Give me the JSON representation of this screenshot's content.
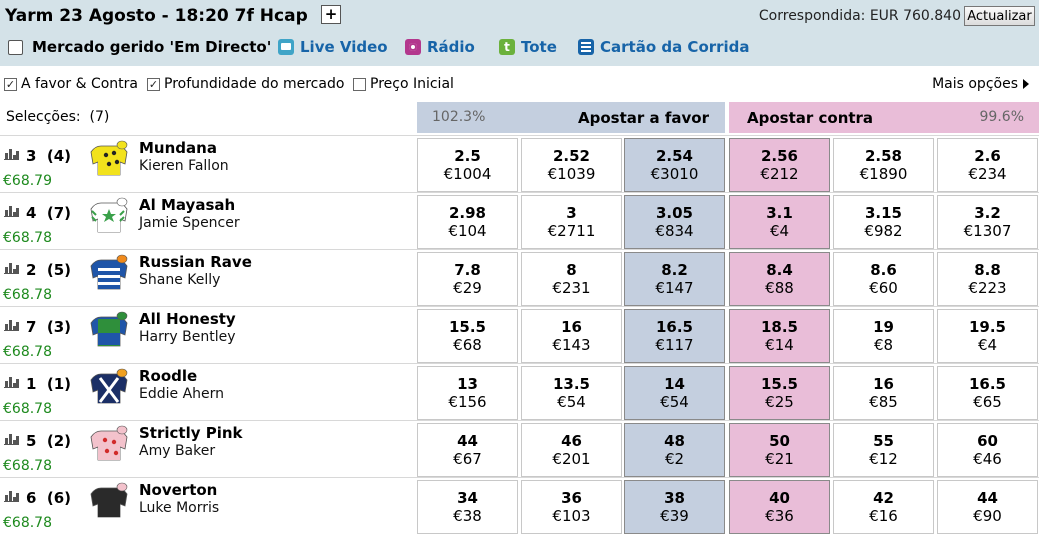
{
  "header": {
    "title": "Yarm 23 Agosto - 18:20 7f Hcap",
    "plus_label": "+",
    "matched": "Correspondida: EUR 760.840",
    "refresh_label": "Actualizar"
  },
  "links": {
    "inplay": "Mercado gerido 'Em Directo'",
    "live_video": "Live Video",
    "radio": "Rádio",
    "tote": "Tote",
    "tote_icon_letter": "t",
    "race_card": "Cartão da Corrida"
  },
  "options": {
    "back_lay": "A favor & Contra",
    "back_lay_checked": true,
    "depth": "Profundidade do mercado",
    "depth_checked": true,
    "sp": "Preço Inicial",
    "sp_checked": false,
    "more": "Mais opções"
  },
  "columns": {
    "selections": "Selecções:",
    "count": "(7)",
    "back_pct": "102.3%",
    "back_label": "Apostar a favor",
    "lay_label": "Apostar contra",
    "lay_pct": "99.6%"
  },
  "runners": [
    {
      "number": "3",
      "draw": "(4)",
      "name": "Mundana",
      "jockey": "Kieren Fallon",
      "pl": "€68.79",
      "silk": "yellow-black-spots",
      "prices": [
        {
          "o": "2.5",
          "a": "€1004"
        },
        {
          "o": "2.52",
          "a": "€1039"
        },
        {
          "o": "2.54",
          "a": "€3010"
        },
        {
          "o": "2.56",
          "a": "€212"
        },
        {
          "o": "2.58",
          "a": "€1890"
        },
        {
          "o": "2.6",
          "a": "€234"
        }
      ]
    },
    {
      "number": "4",
      "draw": "(7)",
      "name": "Al Mayasah",
      "jockey": "Jamie Spencer",
      "pl": "€68.78",
      "silk": "white-green-star",
      "prices": [
        {
          "o": "2.98",
          "a": "€104"
        },
        {
          "o": "3",
          "a": "€2711"
        },
        {
          "o": "3.05",
          "a": "€834"
        },
        {
          "o": "3.1",
          "a": "€4"
        },
        {
          "o": "3.15",
          "a": "€982"
        },
        {
          "o": "3.2",
          "a": "€1307"
        }
      ]
    },
    {
      "number": "2",
      "draw": "(5)",
      "name": "Russian Rave",
      "jockey": "Shane Kelly",
      "pl": "€68.78",
      "silk": "blue-white-hoops",
      "prices": [
        {
          "o": "7.8",
          "a": "€29"
        },
        {
          "o": "8",
          "a": "€231"
        },
        {
          "o": "8.2",
          "a": "€147"
        },
        {
          "o": "8.4",
          "a": "€88"
        },
        {
          "o": "8.6",
          "a": "€60"
        },
        {
          "o": "8.8",
          "a": "€223"
        }
      ]
    },
    {
      "number": "7",
      "draw": "(3)",
      "name": "All Honesty",
      "jockey": "Harry Bentley",
      "pl": "€68.78",
      "silk": "green-blue",
      "prices": [
        {
          "o": "15.5",
          "a": "€68"
        },
        {
          "o": "16",
          "a": "€143"
        },
        {
          "o": "16.5",
          "a": "€117"
        },
        {
          "o": "18.5",
          "a": "€14"
        },
        {
          "o": "19",
          "a": "€8"
        },
        {
          "o": "19.5",
          "a": "€4"
        }
      ]
    },
    {
      "number": "1",
      "draw": "(1)",
      "name": "Roodle",
      "jockey": "Eddie Ahern",
      "pl": "€68.78",
      "silk": "navy-white-cross",
      "prices": [
        {
          "o": "13",
          "a": "€156"
        },
        {
          "o": "13.5",
          "a": "€54"
        },
        {
          "o": "14",
          "a": "€54"
        },
        {
          "o": "15.5",
          "a": "€25"
        },
        {
          "o": "16",
          "a": "€85"
        },
        {
          "o": "16.5",
          "a": "€65"
        }
      ]
    },
    {
      "number": "5",
      "draw": "(2)",
      "name": "Strictly Pink",
      "jockey": "Amy Baker",
      "pl": "€68.78",
      "silk": "pink-red-spots",
      "prices": [
        {
          "o": "44",
          "a": "€67"
        },
        {
          "o": "46",
          "a": "€201"
        },
        {
          "o": "48",
          "a": "€2"
        },
        {
          "o": "50",
          "a": "€21"
        },
        {
          "o": "55",
          "a": "€12"
        },
        {
          "o": "60",
          "a": "€46"
        }
      ]
    },
    {
      "number": "6",
      "draw": "(6)",
      "name": "Noverton",
      "jockey": "Luke Morris",
      "pl": "€68.78",
      "silk": "black-pink-cap",
      "prices": [
        {
          "o": "34",
          "a": "€38"
        },
        {
          "o": "36",
          "a": "€103"
        },
        {
          "o": "38",
          "a": "€39"
        },
        {
          "o": "40",
          "a": "€36"
        },
        {
          "o": "42",
          "a": "€16"
        },
        {
          "o": "44",
          "a": "€90"
        }
      ]
    }
  ]
}
